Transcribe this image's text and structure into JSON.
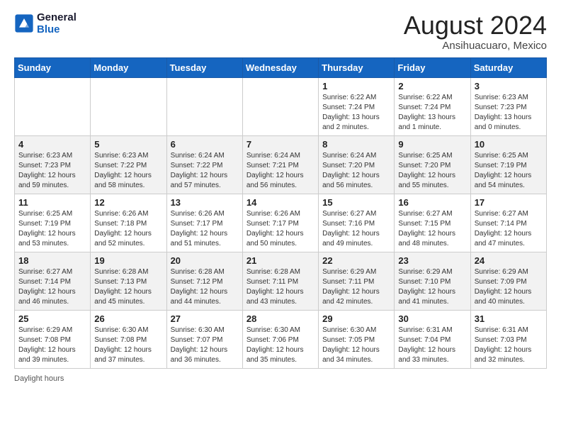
{
  "logo": {
    "line1": "General",
    "line2": "Blue"
  },
  "title": "August 2024",
  "location": "Ansihuacuaro, Mexico",
  "days_of_week": [
    "Sunday",
    "Monday",
    "Tuesday",
    "Wednesday",
    "Thursday",
    "Friday",
    "Saturday"
  ],
  "footer": "Daylight hours",
  "weeks": [
    [
      {
        "num": "",
        "detail": ""
      },
      {
        "num": "",
        "detail": ""
      },
      {
        "num": "",
        "detail": ""
      },
      {
        "num": "",
        "detail": ""
      },
      {
        "num": "1",
        "detail": "Sunrise: 6:22 AM\nSunset: 7:24 PM\nDaylight: 13 hours\nand 2 minutes."
      },
      {
        "num": "2",
        "detail": "Sunrise: 6:22 AM\nSunset: 7:24 PM\nDaylight: 13 hours\nand 1 minute."
      },
      {
        "num": "3",
        "detail": "Sunrise: 6:23 AM\nSunset: 7:23 PM\nDaylight: 13 hours\nand 0 minutes."
      }
    ],
    [
      {
        "num": "4",
        "detail": "Sunrise: 6:23 AM\nSunset: 7:23 PM\nDaylight: 12 hours\nand 59 minutes."
      },
      {
        "num": "5",
        "detail": "Sunrise: 6:23 AM\nSunset: 7:22 PM\nDaylight: 12 hours\nand 58 minutes."
      },
      {
        "num": "6",
        "detail": "Sunrise: 6:24 AM\nSunset: 7:22 PM\nDaylight: 12 hours\nand 57 minutes."
      },
      {
        "num": "7",
        "detail": "Sunrise: 6:24 AM\nSunset: 7:21 PM\nDaylight: 12 hours\nand 56 minutes."
      },
      {
        "num": "8",
        "detail": "Sunrise: 6:24 AM\nSunset: 7:20 PM\nDaylight: 12 hours\nand 56 minutes."
      },
      {
        "num": "9",
        "detail": "Sunrise: 6:25 AM\nSunset: 7:20 PM\nDaylight: 12 hours\nand 55 minutes."
      },
      {
        "num": "10",
        "detail": "Sunrise: 6:25 AM\nSunset: 7:19 PM\nDaylight: 12 hours\nand 54 minutes."
      }
    ],
    [
      {
        "num": "11",
        "detail": "Sunrise: 6:25 AM\nSunset: 7:19 PM\nDaylight: 12 hours\nand 53 minutes."
      },
      {
        "num": "12",
        "detail": "Sunrise: 6:26 AM\nSunset: 7:18 PM\nDaylight: 12 hours\nand 52 minutes."
      },
      {
        "num": "13",
        "detail": "Sunrise: 6:26 AM\nSunset: 7:17 PM\nDaylight: 12 hours\nand 51 minutes."
      },
      {
        "num": "14",
        "detail": "Sunrise: 6:26 AM\nSunset: 7:17 PM\nDaylight: 12 hours\nand 50 minutes."
      },
      {
        "num": "15",
        "detail": "Sunrise: 6:27 AM\nSunset: 7:16 PM\nDaylight: 12 hours\nand 49 minutes."
      },
      {
        "num": "16",
        "detail": "Sunrise: 6:27 AM\nSunset: 7:15 PM\nDaylight: 12 hours\nand 48 minutes."
      },
      {
        "num": "17",
        "detail": "Sunrise: 6:27 AM\nSunset: 7:14 PM\nDaylight: 12 hours\nand 47 minutes."
      }
    ],
    [
      {
        "num": "18",
        "detail": "Sunrise: 6:27 AM\nSunset: 7:14 PM\nDaylight: 12 hours\nand 46 minutes."
      },
      {
        "num": "19",
        "detail": "Sunrise: 6:28 AM\nSunset: 7:13 PM\nDaylight: 12 hours\nand 45 minutes."
      },
      {
        "num": "20",
        "detail": "Sunrise: 6:28 AM\nSunset: 7:12 PM\nDaylight: 12 hours\nand 44 minutes."
      },
      {
        "num": "21",
        "detail": "Sunrise: 6:28 AM\nSunset: 7:11 PM\nDaylight: 12 hours\nand 43 minutes."
      },
      {
        "num": "22",
        "detail": "Sunrise: 6:29 AM\nSunset: 7:11 PM\nDaylight: 12 hours\nand 42 minutes."
      },
      {
        "num": "23",
        "detail": "Sunrise: 6:29 AM\nSunset: 7:10 PM\nDaylight: 12 hours\nand 41 minutes."
      },
      {
        "num": "24",
        "detail": "Sunrise: 6:29 AM\nSunset: 7:09 PM\nDaylight: 12 hours\nand 40 minutes."
      }
    ],
    [
      {
        "num": "25",
        "detail": "Sunrise: 6:29 AM\nSunset: 7:08 PM\nDaylight: 12 hours\nand 39 minutes."
      },
      {
        "num": "26",
        "detail": "Sunrise: 6:30 AM\nSunset: 7:08 PM\nDaylight: 12 hours\nand 37 minutes."
      },
      {
        "num": "27",
        "detail": "Sunrise: 6:30 AM\nSunset: 7:07 PM\nDaylight: 12 hours\nand 36 minutes."
      },
      {
        "num": "28",
        "detail": "Sunrise: 6:30 AM\nSunset: 7:06 PM\nDaylight: 12 hours\nand 35 minutes."
      },
      {
        "num": "29",
        "detail": "Sunrise: 6:30 AM\nSunset: 7:05 PM\nDaylight: 12 hours\nand 34 minutes."
      },
      {
        "num": "30",
        "detail": "Sunrise: 6:31 AM\nSunset: 7:04 PM\nDaylight: 12 hours\nand 33 minutes."
      },
      {
        "num": "31",
        "detail": "Sunrise: 6:31 AM\nSunset: 7:03 PM\nDaylight: 12 hours\nand 32 minutes."
      }
    ]
  ]
}
